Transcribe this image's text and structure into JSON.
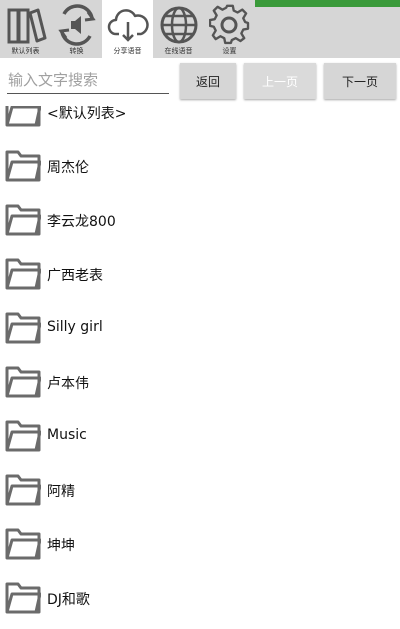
{
  "tabs": [
    {
      "label": "默认列表",
      "icon": "books-icon",
      "active": false
    },
    {
      "label": "转换",
      "icon": "speaker-convert-icon",
      "active": false
    },
    {
      "label": "分享语音",
      "icon": "cloud-download-icon",
      "active": true
    },
    {
      "label": "在线语音",
      "icon": "globe-icon",
      "active": false
    },
    {
      "label": "设置",
      "icon": "gear-icon",
      "active": false
    }
  ],
  "search": {
    "placeholder": "输入文字搜索",
    "value": ""
  },
  "buttons": {
    "back": "返回",
    "prev": "上一页",
    "next": "下一页"
  },
  "folders": [
    "<默认列表>",
    "周杰伦",
    "李云龙800",
    "广西老表",
    "Silly girl",
    "卢本伟",
    "Music",
    "阿精",
    "坤坤",
    "DJ和歌"
  ],
  "colors": {
    "tabbar": "#d6d6d6",
    "icon_gray": "#6b6b6b",
    "accent_green": "#3a9a3a"
  }
}
